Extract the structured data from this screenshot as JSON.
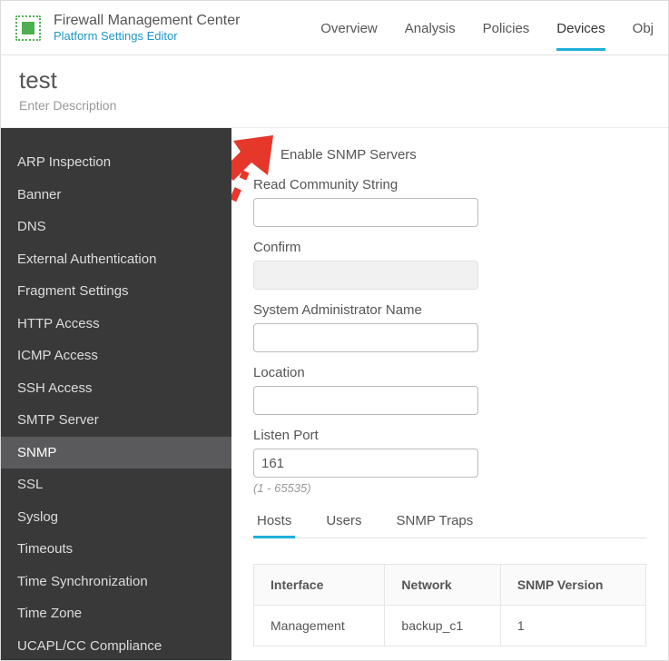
{
  "brand": {
    "title": "Firewall Management Center",
    "subtitle": "Platform Settings Editor"
  },
  "topnav": {
    "items": [
      "Overview",
      "Analysis",
      "Policies",
      "Devices",
      "Obj"
    ],
    "activeIndex": 3
  },
  "page": {
    "title": "test",
    "descPlaceholder": "Enter Description"
  },
  "sidebar": {
    "items": [
      "ARP Inspection",
      "Banner",
      "DNS",
      "External Authentication",
      "Fragment Settings",
      "HTTP Access",
      "ICMP Access",
      "SSH Access",
      "SMTP Server",
      "SNMP",
      "SSL",
      "Syslog",
      "Timeouts",
      "Time Synchronization",
      "Time Zone",
      "UCAPL/CC Compliance"
    ],
    "activeIndex": 9
  },
  "form": {
    "enableLabel": "Enable SNMP Servers",
    "readCommLabel": "Read Community String",
    "confirmLabel": "Confirm",
    "adminLabel": "System Administrator Name",
    "locationLabel": "Location",
    "listenPortLabel": "Listen Port",
    "listenPortValue": "161",
    "listenPortHelp": "(1 - 65535)"
  },
  "tabs": {
    "items": [
      "Hosts",
      "Users",
      "SNMP Traps"
    ],
    "activeIndex": 0
  },
  "table": {
    "headers": [
      "Interface",
      "Network",
      "SNMP Version"
    ],
    "rows": [
      {
        "interface": "Management",
        "network": "backup_c1",
        "version": "1"
      }
    ]
  }
}
